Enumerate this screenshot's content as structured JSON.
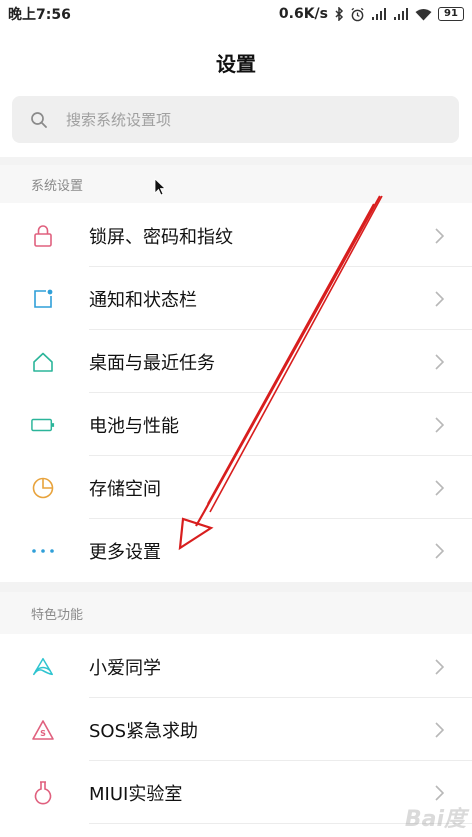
{
  "status_bar": {
    "time": "晚上7:56",
    "speed": "0.6K/s",
    "battery": "91"
  },
  "page": {
    "title": "设置"
  },
  "search": {
    "placeholder": "搜索系统设置项"
  },
  "sections": [
    {
      "header": "系统设置",
      "items": [
        {
          "label": "锁屏、密码和指纹",
          "icon": "lock-icon",
          "color": "#e0607e"
        },
        {
          "label": "通知和状态栏",
          "icon": "notification-icon",
          "color": "#2f9fd8"
        },
        {
          "label": "桌面与最近任务",
          "icon": "home-icon",
          "color": "#2bb59a"
        },
        {
          "label": "电池与性能",
          "icon": "battery-icon",
          "color": "#2bb59a"
        },
        {
          "label": "存储空间",
          "icon": "storage-pie-icon",
          "color": "#e8a33c"
        },
        {
          "label": "更多设置",
          "icon": "more-dots-icon",
          "color": "#2f9fd8"
        }
      ]
    },
    {
      "header": "特色功能",
      "items": [
        {
          "label": "小爱同学",
          "icon": "xiaoai-icon",
          "color": "#2ec4d0"
        },
        {
          "label": "SOS紧急求助",
          "icon": "sos-icon",
          "color": "#e0607e"
        },
        {
          "label": "MIUI实验室",
          "icon": "lab-flask-icon",
          "color": "#e0607e"
        }
      ]
    }
  ],
  "annotation": {
    "color": "#d81e1e"
  },
  "watermark": "Bai度"
}
